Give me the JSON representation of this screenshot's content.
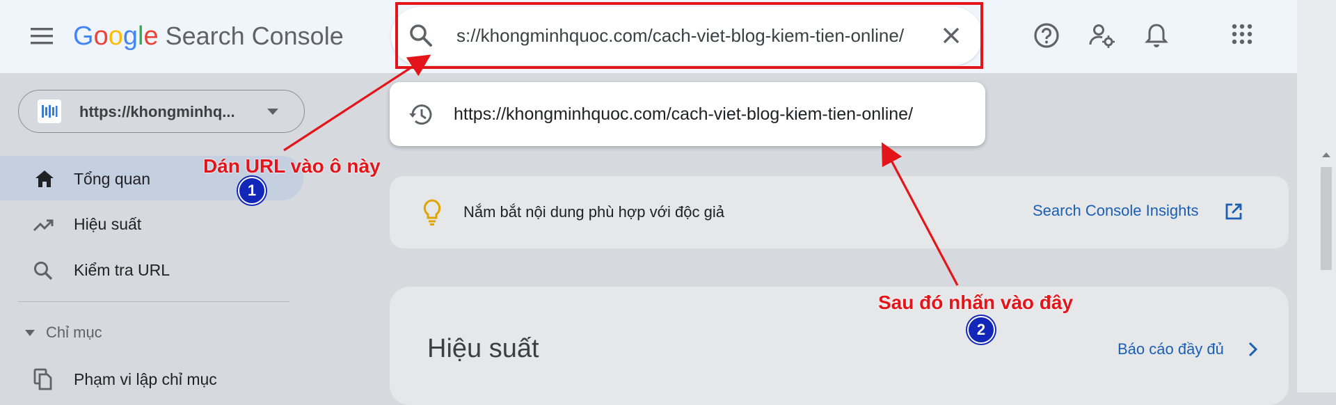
{
  "header": {
    "logo_google": [
      "G",
      "o",
      "o",
      "g",
      "l",
      "e"
    ],
    "product_name": "Search Console",
    "search_value": "s://khongminhquoc.com/cach-viet-blog-kiem-tien-online/",
    "icons": [
      "menu-icon",
      "search-icon",
      "close-icon",
      "help-icon",
      "admin-settings-icon",
      "notifications-icon",
      "apps-icon"
    ]
  },
  "search_suggestion": {
    "text": "https://khongminhquoc.com/cach-viet-blog-kiem-tien-online/",
    "icon": "history-icon"
  },
  "sidebar": {
    "property": "https://khongminhq...",
    "items": [
      {
        "label": "Tổng quan",
        "icon": "home-icon",
        "active": true
      },
      {
        "label": "Hiệu suất",
        "icon": "trending-up-icon"
      },
      {
        "label": "Kiểm tra URL",
        "icon": "search-icon"
      }
    ],
    "section_label": "Chỉ mục",
    "section_items": [
      {
        "label": "Phạm vi lập chỉ mục",
        "icon": "copy-icon"
      }
    ]
  },
  "insight": {
    "text": "Nắm bắt nội dung phù hợp với độc giả",
    "link": "Search Console Insights"
  },
  "performance": {
    "title": "Hiệu suất",
    "link": "Báo cáo đầy đủ"
  },
  "annotations": {
    "step1_text": "Dán URL vào ô này",
    "step1_badge": "1",
    "step2_text": "Sau đó nhấn vào đây",
    "step2_badge": "2",
    "color": "#e3151a",
    "badge_color": "#1226b8"
  },
  "colors": {
    "header_bg": "#f0f4fb",
    "page_bg": "#d6d9de",
    "link": "#1a5fb4",
    "active_nav": "#c4cfdf"
  }
}
